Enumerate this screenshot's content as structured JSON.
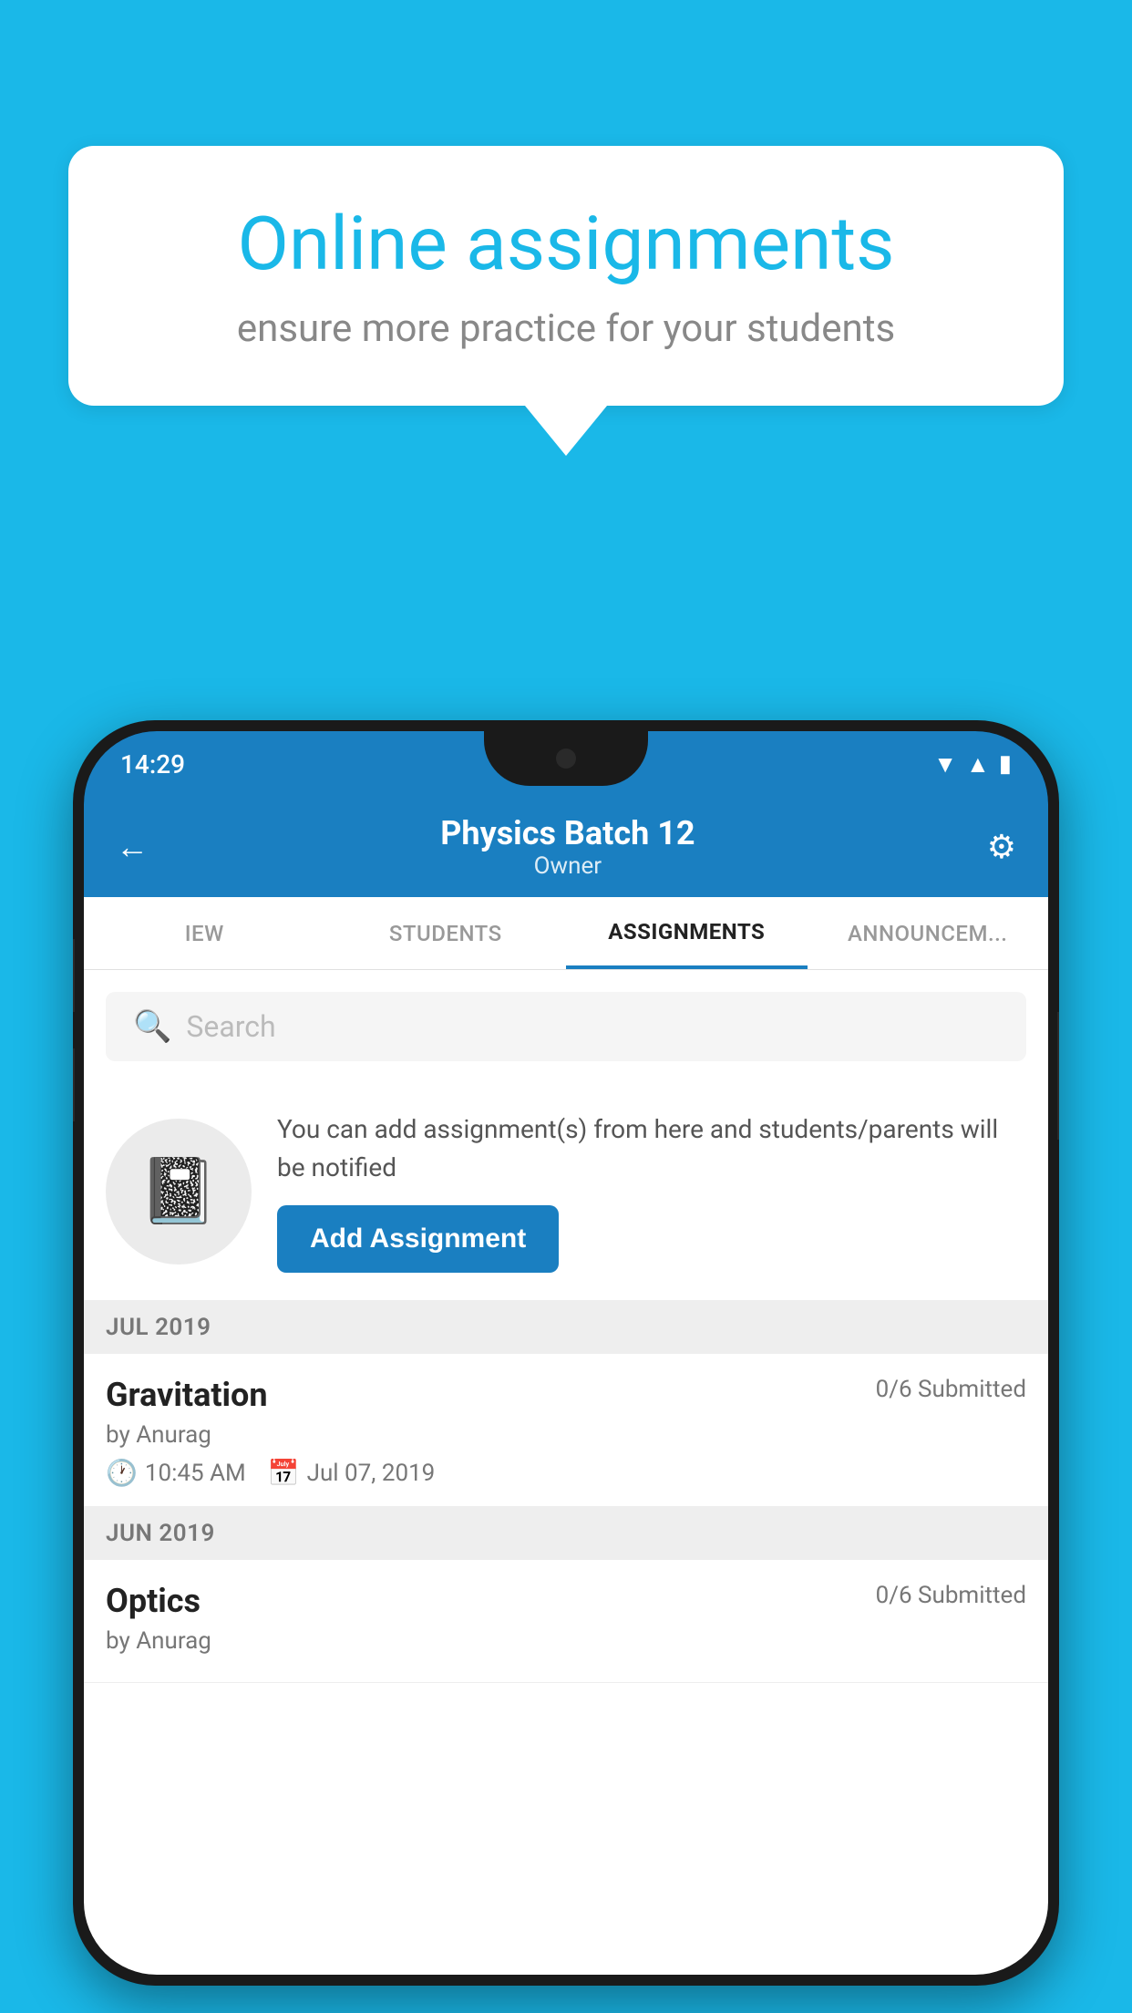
{
  "background_color": "#1ab8e8",
  "speech_bubble": {
    "title": "Online assignments",
    "subtitle": "ensure more practice for your students"
  },
  "status_bar": {
    "time": "14:29"
  },
  "header": {
    "title": "Physics Batch 12",
    "subtitle": "Owner",
    "back_label": "←",
    "settings_label": "⚙"
  },
  "tabs": [
    {
      "label": "IEW",
      "active": false
    },
    {
      "label": "STUDENTS",
      "active": false
    },
    {
      "label": "ASSIGNMENTS",
      "active": true
    },
    {
      "label": "ANNOUNCEM...",
      "active": false
    }
  ],
  "search": {
    "placeholder": "Search"
  },
  "promo": {
    "description": "You can add assignment(s) from here and students/parents will be notified",
    "add_button_label": "Add Assignment"
  },
  "sections": [
    {
      "label": "JUL 2019",
      "assignments": [
        {
          "name": "Gravitation",
          "submitted": "0/6 Submitted",
          "by": "by Anurag",
          "time": "10:45 AM",
          "date": "Jul 07, 2019"
        }
      ]
    },
    {
      "label": "JUN 2019",
      "assignments": [
        {
          "name": "Optics",
          "submitted": "0/6 Submitted",
          "by": "by Anurag",
          "time": "",
          "date": ""
        }
      ]
    }
  ]
}
